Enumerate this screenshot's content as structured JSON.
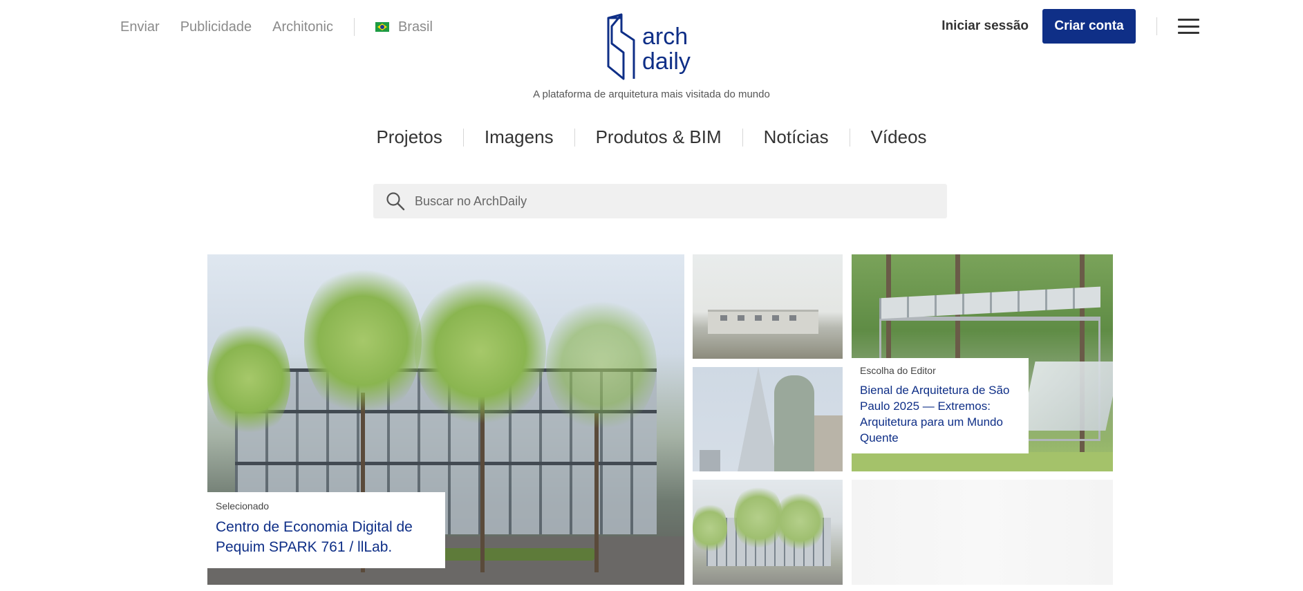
{
  "topbar": {
    "links": [
      "Enviar",
      "Publicidade",
      "Architonic"
    ],
    "country": "Brasil",
    "login_label": "Iniciar sessão",
    "signup_label": "Criar conta"
  },
  "brand": {
    "logo_line1": "arch",
    "logo_line2": "daily",
    "tagline": "A plataforma de arquitetura mais visitada do mundo",
    "color": "#0f2f87"
  },
  "nav": {
    "items": [
      "Projetos",
      "Imagens",
      "Produtos & BIM",
      "Notícias",
      "Vídeos"
    ]
  },
  "search": {
    "placeholder": "Buscar no ArchDaily"
  },
  "featured": {
    "kicker": "Selecionado",
    "title": "Centro de Economia Digital de Pequim SPARK 761 / llLab."
  },
  "editor_pick": {
    "kicker": "Escolha do Editor",
    "title": "Bienal de Arquitetura de São Paulo 2025 — Extremos: Arquitetura para um Mundo Quente"
  },
  "icons": {
    "search": "search-icon",
    "menu": "hamburger-menu-icon",
    "flag": "brazil-flag-icon"
  }
}
